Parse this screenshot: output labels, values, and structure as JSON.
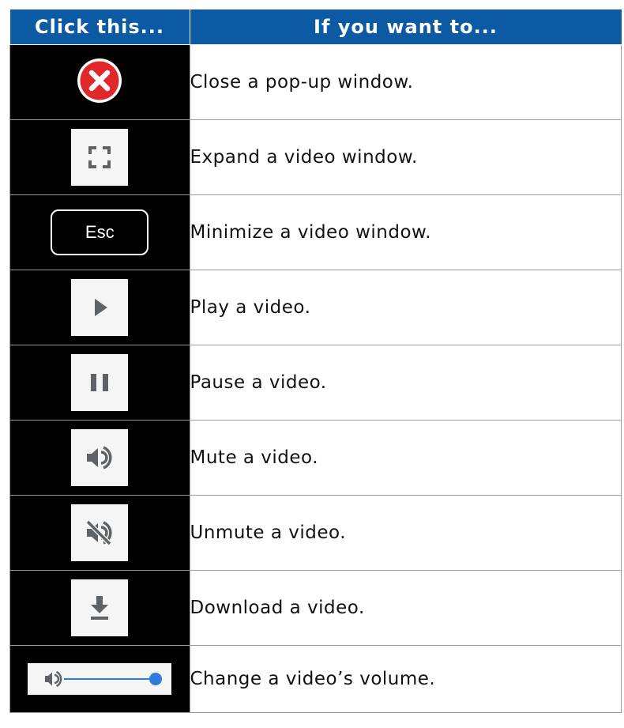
{
  "header": {
    "col1": "Click this...",
    "col2": "If you want to..."
  },
  "rows": [
    {
      "icon": "close-circle-icon",
      "description": "Close a pop-up window."
    },
    {
      "icon": "fullscreen-expand-icon",
      "description": "Expand a video window."
    },
    {
      "icon": "esc-key-icon",
      "key_label": "Esc",
      "description": "Minimize a video window."
    },
    {
      "icon": "play-icon",
      "description": "Play a video."
    },
    {
      "icon": "pause-icon",
      "description": "Pause a video."
    },
    {
      "icon": "volume-on-icon",
      "description": "Mute a video."
    },
    {
      "icon": "volume-muted-icon",
      "description": "Unmute a video."
    },
    {
      "icon": "download-icon",
      "description": "Download a video."
    },
    {
      "icon": "volume-slider-icon",
      "description": "Change a video’s volume.",
      "slider_level": 1.0
    }
  ],
  "colors": {
    "header_bg": "#0b5aa3",
    "icon_cell_bg": "#000000",
    "close_icon": "#e0282b",
    "slider_accent": "#2d7ce0",
    "icon_gray": "#5f6368"
  }
}
